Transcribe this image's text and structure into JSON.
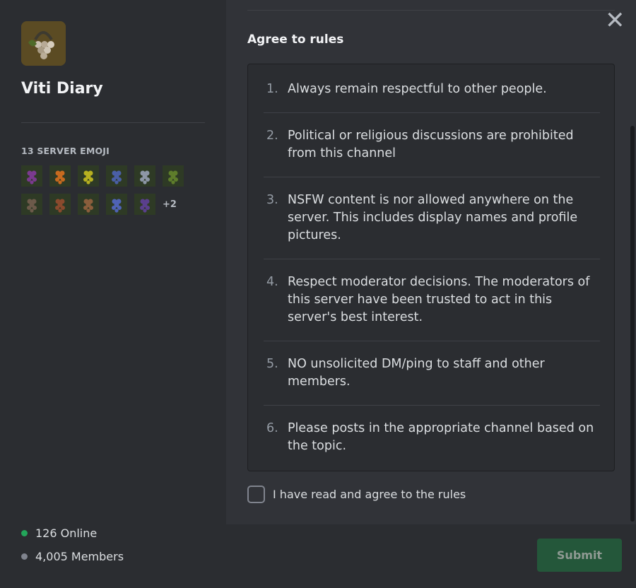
{
  "server": {
    "name": "Viti Diary",
    "icon": "grape-basket-icon",
    "emoji_heading": "13 SERVER EMOJI",
    "emoji": [
      {
        "name": "grape-purple-emoji",
        "color": "#7b3a8f"
      },
      {
        "name": "grape-leaf-orange-emoji",
        "color": "#c66a1f"
      },
      {
        "name": "grape-yellow-emoji",
        "color": "#b7b020"
      },
      {
        "name": "grape-blue-emoji",
        "color": "#4a5fa5"
      },
      {
        "name": "grape-grey-emoji",
        "color": "#8d96a6"
      },
      {
        "name": "grape-green-emoji",
        "color": "#5e7d2b"
      },
      {
        "name": "vine-stem-emoji",
        "color": "#6c5a4a"
      },
      {
        "name": "wine-barrel-emoji",
        "color": "#8a4a2d"
      },
      {
        "name": "cork-emoji",
        "color": "#8b5e3c"
      },
      {
        "name": "grape-cluster-blue-emoji",
        "color": "#4f63b5"
      },
      {
        "name": "grape-cluster-dark-emoji",
        "color": "#5a3f8d"
      }
    ],
    "emoji_more": "+2",
    "online": "126 Online",
    "members": "4,005 Members"
  },
  "rules": {
    "title": "Agree to rules",
    "items": [
      {
        "num": "1.",
        "text": "Always remain respectful to other people."
      },
      {
        "num": "2.",
        "text": "Political or religious discussions are prohibited from this channel"
      },
      {
        "num": "3.",
        "text": "NSFW content is nor allowed anywhere on the server. This includes display names and profile pictures."
      },
      {
        "num": "4.",
        "text": "Respect moderator decisions. The moderators of this server have been trusted to act in this server's best interest."
      },
      {
        "num": "5.",
        "text": "NO unsolicited DM/ping to staff and other members."
      },
      {
        "num": "6.",
        "text": "Please posts in the appropriate channel based on the topic."
      }
    ],
    "agree_label": "I have read and agree to the rules",
    "agreed": false,
    "submit_label": "Submit"
  },
  "colors": {
    "online": "#23a55a",
    "submit_bg": "#24573a",
    "panel": "#313338",
    "sidebar": "#2b2d31"
  }
}
